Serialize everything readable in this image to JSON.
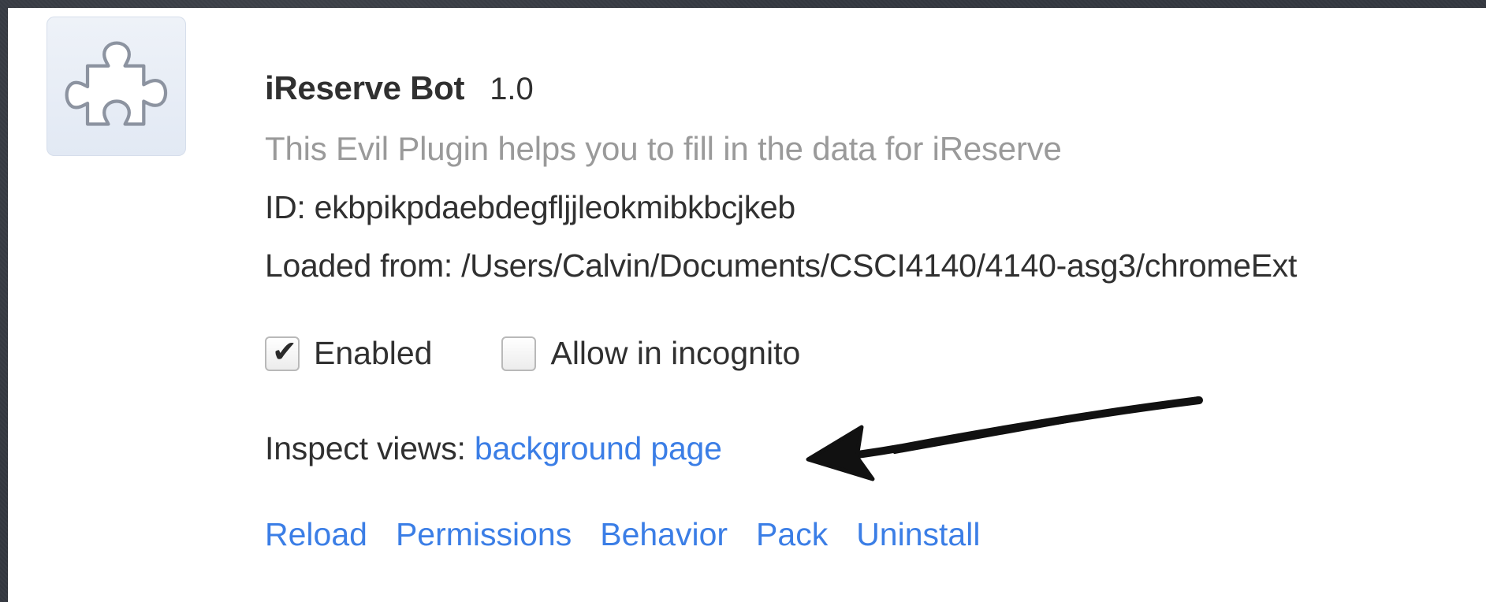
{
  "extension": {
    "icon": "puzzle-piece-icon",
    "name": "iReserve Bot",
    "version": "1.0",
    "description": "This Evil Plugin helps you to fill in the data for iReserve",
    "id_text": "ID: ekbpikpdaebdegfljjleokmibkbcjkeb",
    "loaded_from_text": "Loaded from: /Users/Calvin/Documents/CSCI4140/4140-asg3/chromeExt",
    "checkboxes": {
      "enabled": {
        "label": "Enabled",
        "checked": true
      },
      "incognito": {
        "label": "Allow in incognito",
        "checked": false
      }
    },
    "inspect_views": {
      "label": "Inspect views: ",
      "link": "background page"
    },
    "actions": [
      "Reload",
      "Permissions",
      "Behavior",
      "Pack",
      "Uninstall"
    ]
  },
  "annotation": {
    "type": "hand-drawn-arrow",
    "points_to": "background page"
  },
  "colors": {
    "link": "#3b7ee6",
    "text": "#303030",
    "description": "#9a9a9a",
    "background": "#343840"
  }
}
